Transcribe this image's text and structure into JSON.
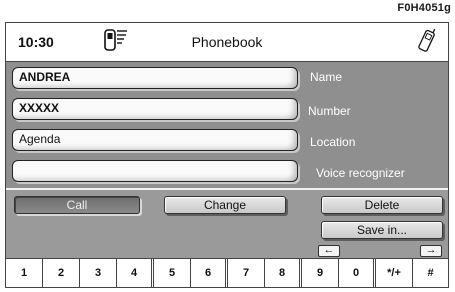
{
  "figure_code": "F0H4051g",
  "header": {
    "time": "10:30",
    "title": "Phonebook",
    "signal_icon": "phone-signal-icon",
    "phone_icon": "mobile-phone-icon"
  },
  "fields": [
    {
      "value": "ANDREA",
      "label": "Name"
    },
    {
      "value": "XXXXX",
      "label": "Number"
    },
    {
      "value": "Agenda",
      "label": "Location"
    },
    {
      "value": "",
      "label": "Voice recognizer"
    }
  ],
  "buttons": {
    "call": "Call",
    "change": "Change",
    "delete": "Delete",
    "save_in": "Save in...",
    "left_arrow": "←",
    "right_arrow": "→"
  },
  "keypad": [
    "1",
    "2",
    "3",
    "4",
    "5",
    "6",
    "7",
    "8",
    "9",
    "0",
    "*/+",
    "#"
  ],
  "colors": {
    "screen_bg": "#9c9c9c",
    "field_bg": "#fafafa",
    "label_text": "#ffffff",
    "pressed_button": "#6e6e6e"
  }
}
